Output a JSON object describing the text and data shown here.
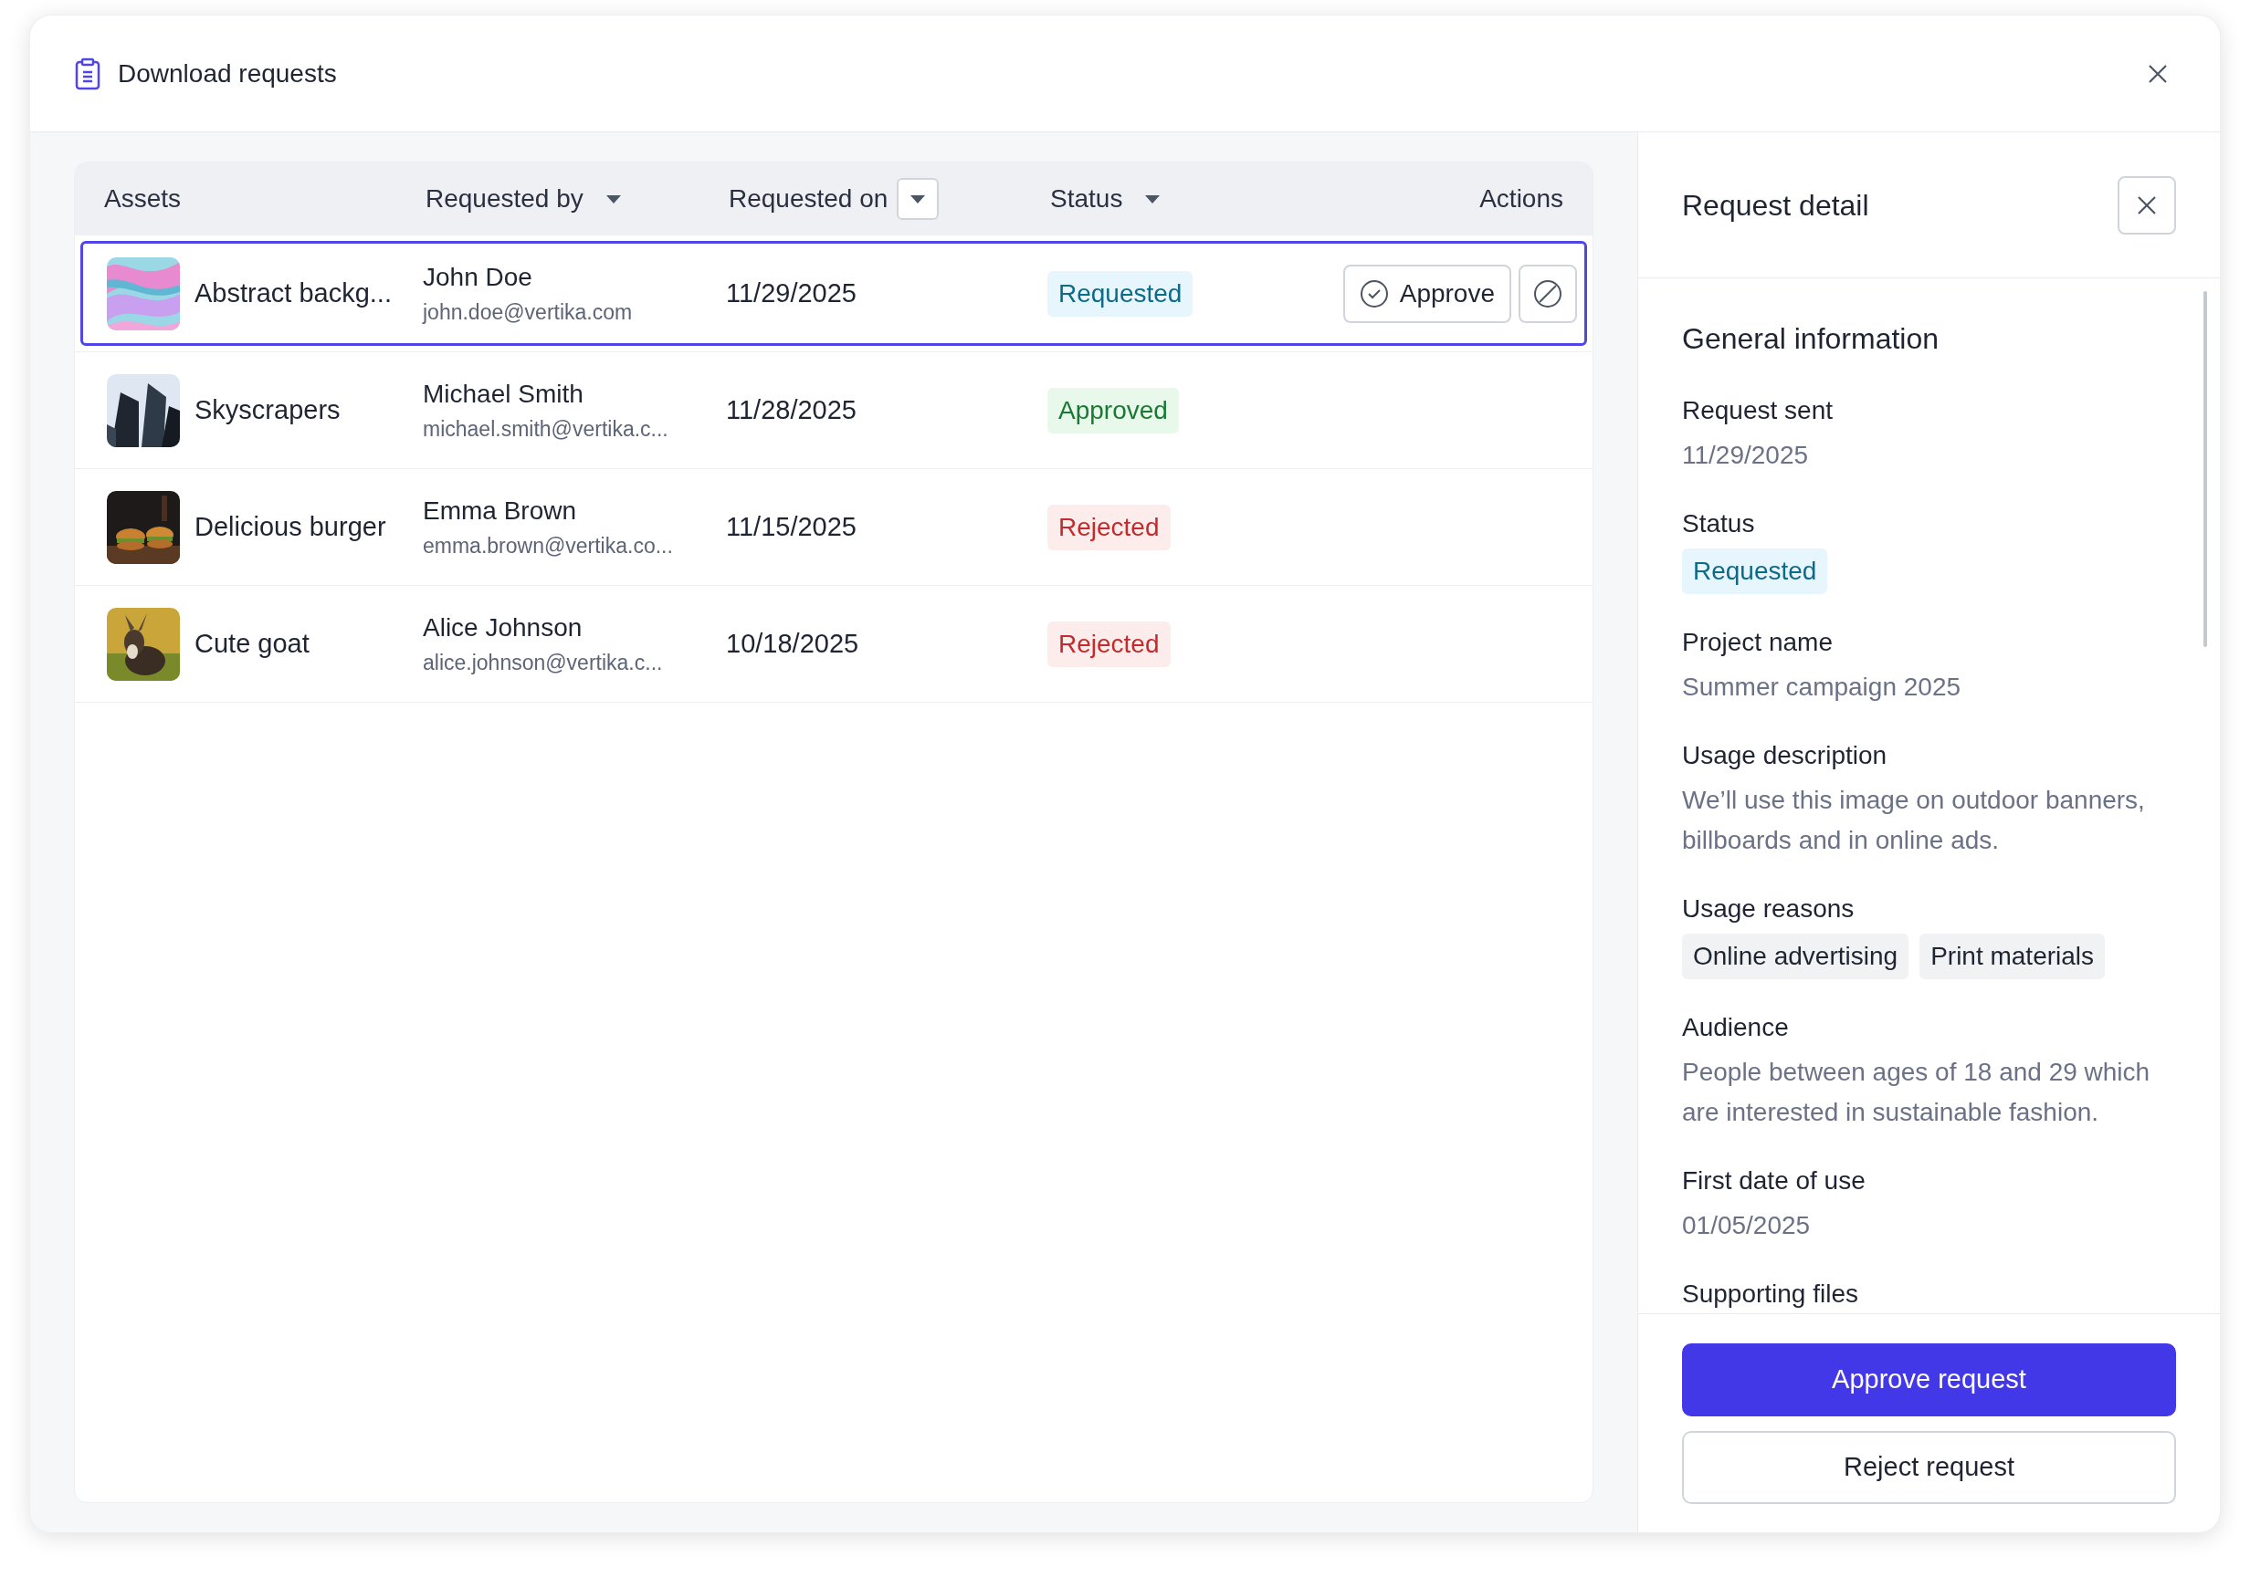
{
  "dialog": {
    "title": "Download requests"
  },
  "table": {
    "columns": [
      {
        "label": "Assets",
        "sortable": false
      },
      {
        "label": "Requested by",
        "sortable": true,
        "sorted": false
      },
      {
        "label": "Requested on",
        "sortable": true,
        "sorted": true
      },
      {
        "label": "Status",
        "sortable": true,
        "sorted": false
      },
      {
        "label": "Actions",
        "sortable": false
      }
    ],
    "rows": [
      {
        "asset": "Abstract backg...",
        "name": "John Doe",
        "email": "john.doe@vertika.com",
        "date": "11/29/2025",
        "status": {
          "label": "Requested",
          "kind": "requested"
        },
        "selected": true,
        "actions": {
          "approve": "Approve"
        }
      },
      {
        "asset": "Skyscrapers",
        "name": "Michael Smith",
        "email": "michael.smith@vertika.c...",
        "date": "11/28/2025",
        "status": {
          "label": "Approved",
          "kind": "approved"
        },
        "selected": false
      },
      {
        "asset": "Delicious burger",
        "name": "Emma Brown",
        "email": "emma.brown@vertika.co...",
        "date": "11/15/2025",
        "status": {
          "label": "Rejected",
          "kind": "rejected"
        },
        "selected": false
      },
      {
        "asset": "Cute goat",
        "name": "Alice Johnson",
        "email": "alice.johnson@vertika.c...",
        "date": "10/18/2025",
        "status": {
          "label": "Rejected",
          "kind": "rejected"
        },
        "selected": false
      }
    ]
  },
  "detail": {
    "title": "Request detail",
    "section": "General information",
    "fields": [
      {
        "kind": "text",
        "label": "Request sent",
        "value": "11/29/2025"
      },
      {
        "kind": "status",
        "label": "Status",
        "status": {
          "label": "Requested",
          "kind": "requested"
        }
      },
      {
        "kind": "text",
        "label": "Project name",
        "value": "Summer campaign 2025"
      },
      {
        "kind": "text",
        "label": "Usage description",
        "value": "We’ll use this image on outdoor banners, billboards and in online ads."
      },
      {
        "kind": "tags",
        "label": "Usage reasons",
        "tags": [
          "Online advertising",
          "Print materials"
        ]
      },
      {
        "kind": "text",
        "label": "Audience",
        "value": "People between ages of 18 and 29 which are interested in sustainable fashion."
      },
      {
        "kind": "text",
        "label": "First date of use",
        "value": "01/05/2025"
      },
      {
        "kind": "heading",
        "label": "Supporting files"
      }
    ],
    "buttons": {
      "approve": "Approve request",
      "reject": "Reject request"
    }
  }
}
